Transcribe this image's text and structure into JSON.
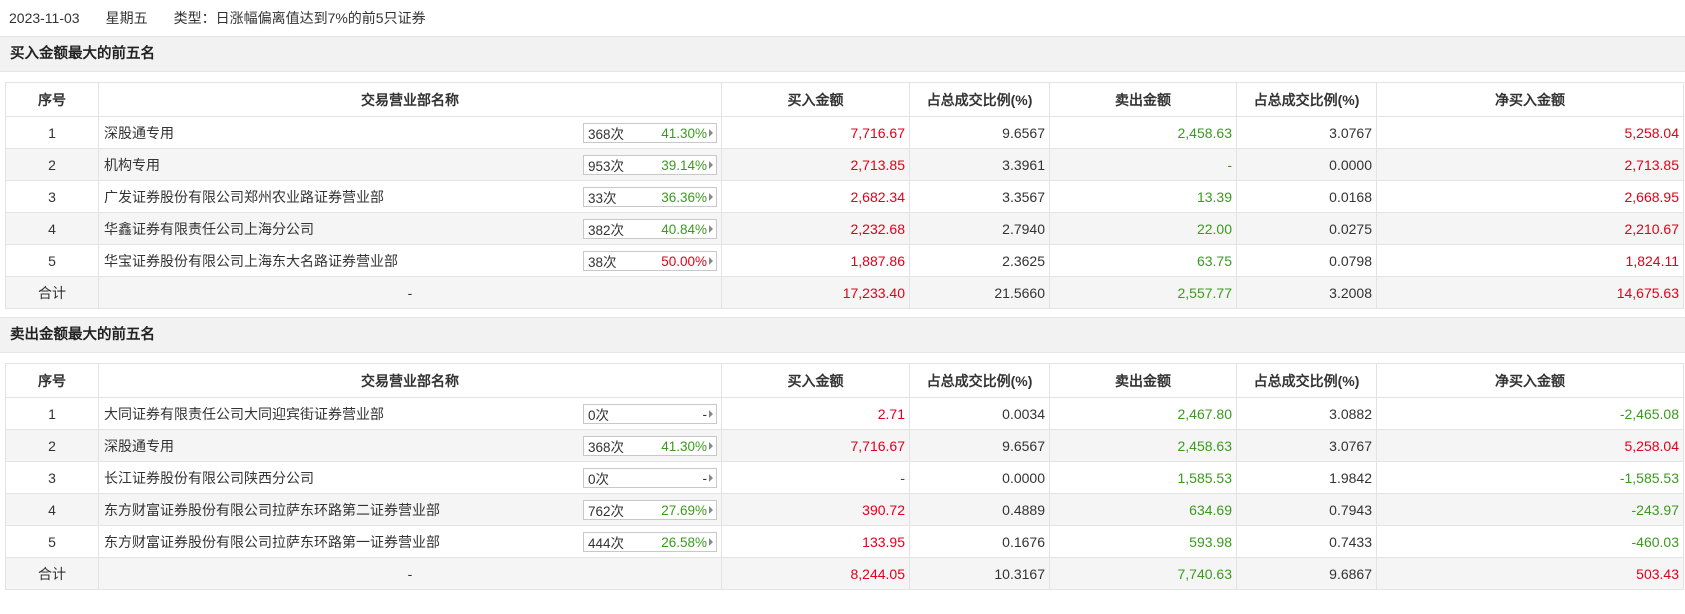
{
  "header": {
    "date": "2023-11-03",
    "weekday": "星期五",
    "type": "类型：日涨幅偏离值达到7%的前5只证券"
  },
  "columns": [
    "序号",
    "交易营业部名称",
    "买入金额",
    "占总成交比例(%)",
    "卖出金额",
    "占总成交比例(%)",
    "净买入金额"
  ],
  "buy": {
    "title": "买入金额最大的前五名",
    "rows": [
      {
        "no": "1",
        "name": "深股通专用",
        "count": "368次",
        "pct": "41.30%",
        "pct_color": "green",
        "buy": "7,716.67",
        "buy_ratio": "9.6567",
        "sell": "2,458.63",
        "sell_ratio": "3.0767",
        "net": "5,258.04",
        "net_color": "red"
      },
      {
        "no": "2",
        "name": "机构专用",
        "count": "953次",
        "pct": "39.14%",
        "pct_color": "green",
        "buy": "2,713.85",
        "buy_ratio": "3.3961",
        "sell": "-",
        "sell_ratio": "0.0000",
        "net": "2,713.85",
        "net_color": "red"
      },
      {
        "no": "3",
        "name": "广发证券股份有限公司郑州农业路证券营业部",
        "count": "33次",
        "pct": "36.36%",
        "pct_color": "green",
        "buy": "2,682.34",
        "buy_ratio": "3.3567",
        "sell": "13.39",
        "sell_ratio": "0.0168",
        "net": "2,668.95",
        "net_color": "red"
      },
      {
        "no": "4",
        "name": "华鑫证券有限责任公司上海分公司",
        "count": "382次",
        "pct": "40.84%",
        "pct_color": "green",
        "buy": "2,232.68",
        "buy_ratio": "2.7940",
        "sell": "22.00",
        "sell_ratio": "0.0275",
        "net": "2,210.67",
        "net_color": "red"
      },
      {
        "no": "5",
        "name": "华宝证券股份有限公司上海东大名路证券营业部",
        "count": "38次",
        "pct": "50.00%",
        "pct_color": "red",
        "buy": "1,887.86",
        "buy_ratio": "2.3625",
        "sell": "63.75",
        "sell_ratio": "0.0798",
        "net": "1,824.11",
        "net_color": "red"
      }
    ],
    "total": {
      "label": "合计",
      "name": "-",
      "buy": "17,233.40",
      "buy_ratio": "21.5660",
      "sell": "2,557.77",
      "sell_ratio": "3.2008",
      "net": "14,675.63",
      "net_color": "red"
    }
  },
  "sell": {
    "title": "卖出金额最大的前五名",
    "rows": [
      {
        "no": "1",
        "name": "大同证券有限责任公司大同迎宾街证券营业部",
        "count": "0次",
        "pct": "-",
        "pct_color": "neutral",
        "buy": "2.71",
        "buy_ratio": "0.0034",
        "sell": "2,467.80",
        "sell_ratio": "3.0882",
        "net": "-2,465.08",
        "net_color": "green"
      },
      {
        "no": "2",
        "name": "深股通专用",
        "count": "368次",
        "pct": "41.30%",
        "pct_color": "green",
        "buy": "7,716.67",
        "buy_ratio": "9.6567",
        "sell": "2,458.63",
        "sell_ratio": "3.0767",
        "net": "5,258.04",
        "net_color": "red"
      },
      {
        "no": "3",
        "name": "长江证券股份有限公司陕西分公司",
        "count": "0次",
        "pct": "-",
        "pct_color": "neutral",
        "buy": "-",
        "buy_ratio": "0.0000",
        "sell": "1,585.53",
        "sell_ratio": "1.9842",
        "net": "-1,585.53",
        "net_color": "green"
      },
      {
        "no": "4",
        "name": "东方财富证券股份有限公司拉萨东环路第二证券营业部",
        "count": "762次",
        "pct": "27.69%",
        "pct_color": "green",
        "buy": "390.72",
        "buy_ratio": "0.4889",
        "sell": "634.69",
        "sell_ratio": "0.7943",
        "net": "-243.97",
        "net_color": "green"
      },
      {
        "no": "5",
        "name": "东方财富证券股份有限公司拉萨东环路第一证券营业部",
        "count": "444次",
        "pct": "26.58%",
        "pct_color": "green",
        "buy": "133.95",
        "buy_ratio": "0.1676",
        "sell": "593.98",
        "sell_ratio": "0.7433",
        "net": "-460.03",
        "net_color": "green"
      }
    ],
    "total": {
      "label": "合计",
      "name": "-",
      "buy": "8,244.05",
      "buy_ratio": "10.3167",
      "sell": "7,740.63",
      "sell_ratio": "9.6867",
      "net": "503.43",
      "net_color": "red"
    }
  },
  "colors": {
    "up": "#e0001b",
    "down": "#3b9a1e"
  }
}
